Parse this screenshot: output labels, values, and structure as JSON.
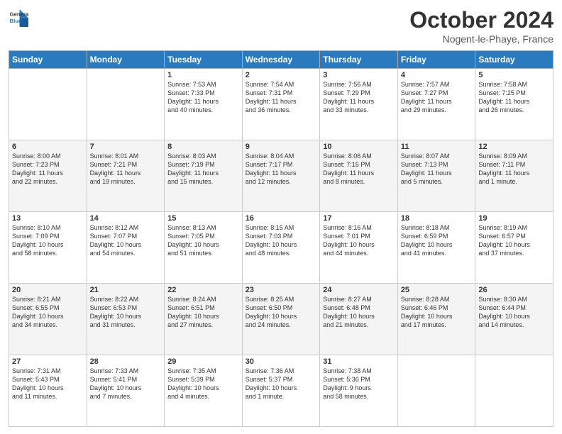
{
  "header": {
    "logo_line1": "General",
    "logo_line2": "Blue",
    "month_title": "October 2024",
    "location": "Nogent-le-Phaye, France"
  },
  "days_of_week": [
    "Sunday",
    "Monday",
    "Tuesday",
    "Wednesday",
    "Thursday",
    "Friday",
    "Saturday"
  ],
  "weeks": [
    [
      {
        "day": "",
        "info": ""
      },
      {
        "day": "",
        "info": ""
      },
      {
        "day": "1",
        "info": "Sunrise: 7:53 AM\nSunset: 7:33 PM\nDaylight: 11 hours\nand 40 minutes."
      },
      {
        "day": "2",
        "info": "Sunrise: 7:54 AM\nSunset: 7:31 PM\nDaylight: 11 hours\nand 36 minutes."
      },
      {
        "day": "3",
        "info": "Sunrise: 7:56 AM\nSunset: 7:29 PM\nDaylight: 11 hours\nand 33 minutes."
      },
      {
        "day": "4",
        "info": "Sunrise: 7:57 AM\nSunset: 7:27 PM\nDaylight: 11 hours\nand 29 minutes."
      },
      {
        "day": "5",
        "info": "Sunrise: 7:58 AM\nSunset: 7:25 PM\nDaylight: 11 hours\nand 26 minutes."
      }
    ],
    [
      {
        "day": "6",
        "info": "Sunrise: 8:00 AM\nSunset: 7:23 PM\nDaylight: 11 hours\nand 22 minutes."
      },
      {
        "day": "7",
        "info": "Sunrise: 8:01 AM\nSunset: 7:21 PM\nDaylight: 11 hours\nand 19 minutes."
      },
      {
        "day": "8",
        "info": "Sunrise: 8:03 AM\nSunset: 7:19 PM\nDaylight: 11 hours\nand 15 minutes."
      },
      {
        "day": "9",
        "info": "Sunrise: 8:04 AM\nSunset: 7:17 PM\nDaylight: 11 hours\nand 12 minutes."
      },
      {
        "day": "10",
        "info": "Sunrise: 8:06 AM\nSunset: 7:15 PM\nDaylight: 11 hours\nand 8 minutes."
      },
      {
        "day": "11",
        "info": "Sunrise: 8:07 AM\nSunset: 7:13 PM\nDaylight: 11 hours\nand 5 minutes."
      },
      {
        "day": "12",
        "info": "Sunrise: 8:09 AM\nSunset: 7:11 PM\nDaylight: 11 hours\nand 1 minute."
      }
    ],
    [
      {
        "day": "13",
        "info": "Sunrise: 8:10 AM\nSunset: 7:09 PM\nDaylight: 10 hours\nand 58 minutes."
      },
      {
        "day": "14",
        "info": "Sunrise: 8:12 AM\nSunset: 7:07 PM\nDaylight: 10 hours\nand 54 minutes."
      },
      {
        "day": "15",
        "info": "Sunrise: 8:13 AM\nSunset: 7:05 PM\nDaylight: 10 hours\nand 51 minutes."
      },
      {
        "day": "16",
        "info": "Sunrise: 8:15 AM\nSunset: 7:03 PM\nDaylight: 10 hours\nand 48 minutes."
      },
      {
        "day": "17",
        "info": "Sunrise: 8:16 AM\nSunset: 7:01 PM\nDaylight: 10 hours\nand 44 minutes."
      },
      {
        "day": "18",
        "info": "Sunrise: 8:18 AM\nSunset: 6:59 PM\nDaylight: 10 hours\nand 41 minutes."
      },
      {
        "day": "19",
        "info": "Sunrise: 8:19 AM\nSunset: 6:57 PM\nDaylight: 10 hours\nand 37 minutes."
      }
    ],
    [
      {
        "day": "20",
        "info": "Sunrise: 8:21 AM\nSunset: 6:55 PM\nDaylight: 10 hours\nand 34 minutes."
      },
      {
        "day": "21",
        "info": "Sunrise: 8:22 AM\nSunset: 6:53 PM\nDaylight: 10 hours\nand 31 minutes."
      },
      {
        "day": "22",
        "info": "Sunrise: 8:24 AM\nSunset: 6:51 PM\nDaylight: 10 hours\nand 27 minutes."
      },
      {
        "day": "23",
        "info": "Sunrise: 8:25 AM\nSunset: 6:50 PM\nDaylight: 10 hours\nand 24 minutes."
      },
      {
        "day": "24",
        "info": "Sunrise: 8:27 AM\nSunset: 6:48 PM\nDaylight: 10 hours\nand 21 minutes."
      },
      {
        "day": "25",
        "info": "Sunrise: 8:28 AM\nSunset: 6:46 PM\nDaylight: 10 hours\nand 17 minutes."
      },
      {
        "day": "26",
        "info": "Sunrise: 8:30 AM\nSunset: 6:44 PM\nDaylight: 10 hours\nand 14 minutes."
      }
    ],
    [
      {
        "day": "27",
        "info": "Sunrise: 7:31 AM\nSunset: 5:43 PM\nDaylight: 10 hours\nand 11 minutes."
      },
      {
        "day": "28",
        "info": "Sunrise: 7:33 AM\nSunset: 5:41 PM\nDaylight: 10 hours\nand 7 minutes."
      },
      {
        "day": "29",
        "info": "Sunrise: 7:35 AM\nSunset: 5:39 PM\nDaylight: 10 hours\nand 4 minutes."
      },
      {
        "day": "30",
        "info": "Sunrise: 7:36 AM\nSunset: 5:37 PM\nDaylight: 10 hours\nand 1 minute."
      },
      {
        "day": "31",
        "info": "Sunrise: 7:38 AM\nSunset: 5:36 PM\nDaylight: 9 hours\nand 58 minutes."
      },
      {
        "day": "",
        "info": ""
      },
      {
        "day": "",
        "info": ""
      }
    ]
  ]
}
